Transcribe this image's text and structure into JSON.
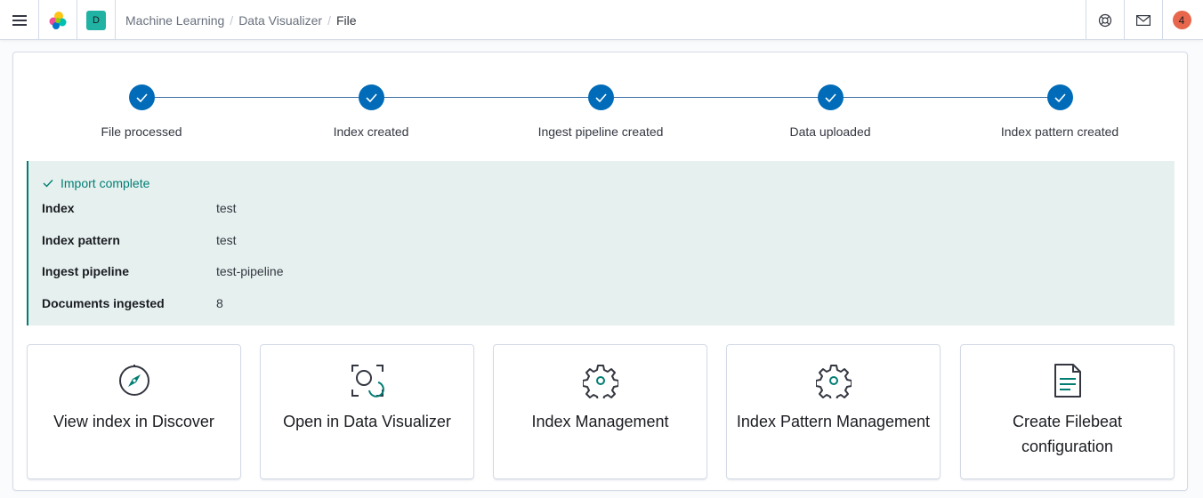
{
  "header": {
    "space_initial": "D",
    "breadcrumbs": [
      "Machine Learning",
      "Data Visualizer"
    ],
    "breadcrumb_separator": "/",
    "current": "File",
    "notification_count": "4"
  },
  "steps": [
    {
      "label": "File processed",
      "status": "complete"
    },
    {
      "label": "Index created",
      "status": "complete"
    },
    {
      "label": "Ingest pipeline created",
      "status": "complete"
    },
    {
      "label": "Data uploaded",
      "status": "complete"
    },
    {
      "label": "Index pattern created",
      "status": "complete"
    }
  ],
  "import": {
    "title": "Import complete",
    "rows": [
      {
        "label": "Index",
        "value": "test"
      },
      {
        "label": "Index pattern",
        "value": "test"
      },
      {
        "label": "Ingest pipeline",
        "value": "test-pipeline"
      },
      {
        "label": "Documents ingested",
        "value": "8"
      }
    ]
  },
  "cards": [
    {
      "title": "View index in Discover",
      "icon": "compass-icon"
    },
    {
      "title": "Open in Data Visualizer",
      "icon": "data-visualizer-icon"
    },
    {
      "title": "Index Management",
      "icon": "gear-icon"
    },
    {
      "title": "Index Pattern Management",
      "icon": "gear-icon"
    },
    {
      "title": "Create Filebeat configuration",
      "icon": "document-icon"
    }
  ],
  "colors": {
    "step": "#006bb8",
    "success": "#017d73",
    "callout_bg": "#e6f1ef",
    "space_badge": "#20b2a2",
    "notification_badge": "#e7664c"
  }
}
